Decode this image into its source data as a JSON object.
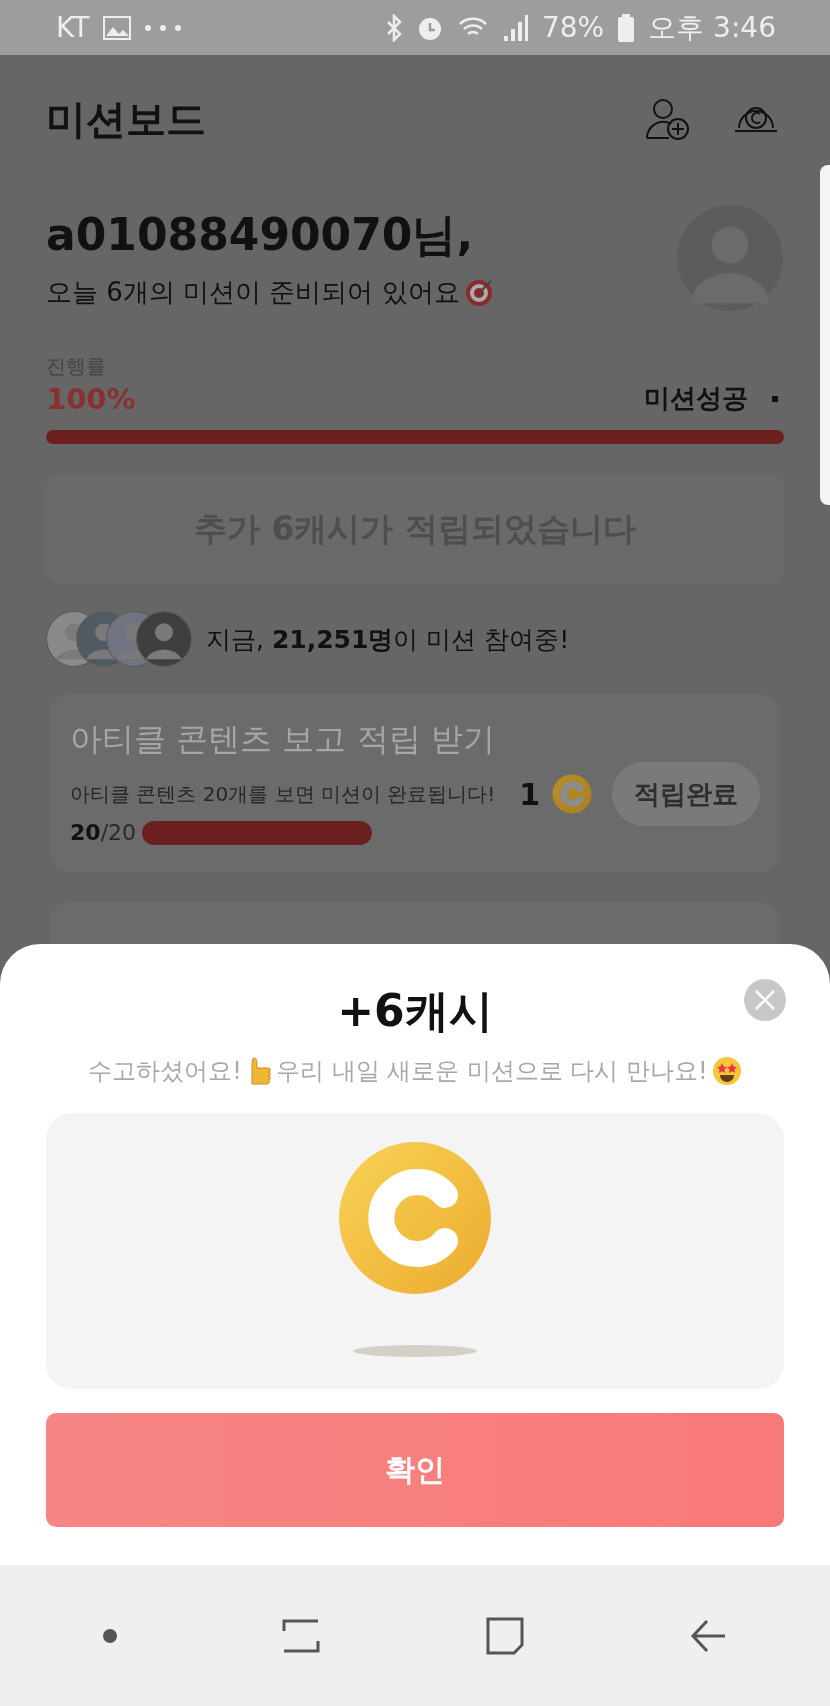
{
  "status_bar": {
    "carrier": "KT",
    "battery": "78%",
    "time": "오후 3:46"
  },
  "header": {
    "title": "미션보드"
  },
  "greeting": {
    "name": "a01088490070님,",
    "message": "오늘 6개의 미션이 준비되어 있어요"
  },
  "progress": {
    "label": "진행률",
    "percent": "100%",
    "status": "미션성공",
    "level": 1
  },
  "banner": "추가 6캐시가 적립되었습니다",
  "participants": "지금, **21,251명**이 미션 참여중!",
  "missions": [
    {
      "title": "아티클 콘텐츠 보고 적립 받기",
      "description": "아티클 콘텐츠 20개를 보면 미션이 완료됩니다!",
      "count": "**20**/20",
      "level": 1,
      "reward": "1",
      "button": "적립완료",
      "completed": true
    }
  ],
  "sheet": {
    "title": "+6캐시",
    "message_1": "수고하셨어요!",
    "message_2": "우리 내일 새로운 미션으로 다시 만나요!",
    "confirm": "확인"
  }
}
